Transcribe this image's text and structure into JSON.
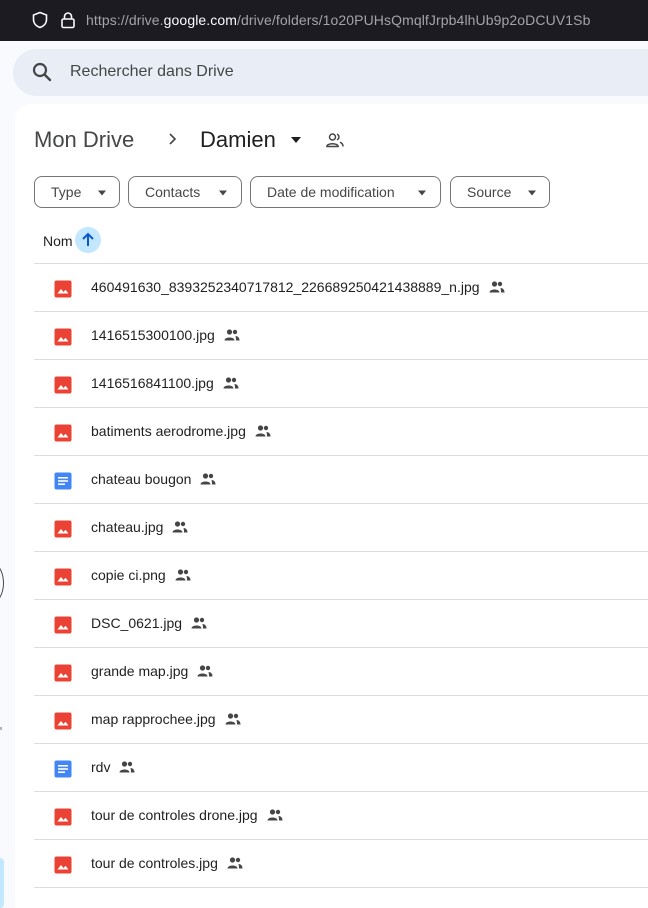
{
  "browser": {
    "url_pre": "https://drive.",
    "url_domain": "google.com",
    "url_post": "/drive/folders/1o20PUHsQmqlfJrpb4lhUb9p2oDCUV1Sb"
  },
  "search": {
    "placeholder": "Rechercher dans Drive"
  },
  "breadcrumb": {
    "root": "Mon Drive",
    "current": "Damien"
  },
  "filters": [
    {
      "label": "Type"
    },
    {
      "label": "Contacts"
    },
    {
      "label": "Date de modification"
    },
    {
      "label": "Source"
    }
  ],
  "list": {
    "column_name": "Nom",
    "sort": "ascending",
    "files": [
      {
        "name": "460491630_8393252340717812_226689250421438889_n.jpg",
        "type": "image",
        "shared": true
      },
      {
        "name": "1416515300100.jpg",
        "type": "image",
        "shared": true
      },
      {
        "name": "1416516841100.jpg",
        "type": "image",
        "shared": true
      },
      {
        "name": "batiments aerodrome.jpg",
        "type": "image",
        "shared": true
      },
      {
        "name": "chateau bougon",
        "type": "doc",
        "shared": true
      },
      {
        "name": "chateau.jpg",
        "type": "image",
        "shared": true
      },
      {
        "name": "copie ci.png",
        "type": "image",
        "shared": true
      },
      {
        "name": "DSC_0621.jpg",
        "type": "image",
        "shared": true
      },
      {
        "name": "grande map.jpg",
        "type": "image",
        "shared": true
      },
      {
        "name": "map rapprochee.jpg",
        "type": "image",
        "shared": true
      },
      {
        "name": "rdv",
        "type": "doc",
        "shared": true
      },
      {
        "name": "tour de controles drone.jpg",
        "type": "image",
        "shared": true
      },
      {
        "name": "tour de controles.jpg",
        "type": "image",
        "shared": true
      }
    ]
  },
  "colors": {
    "image_icon": "#ea4335",
    "doc_icon": "#4285f4",
    "sort_chip": "#c2e7ff",
    "search_bg": "#e9eef6"
  }
}
